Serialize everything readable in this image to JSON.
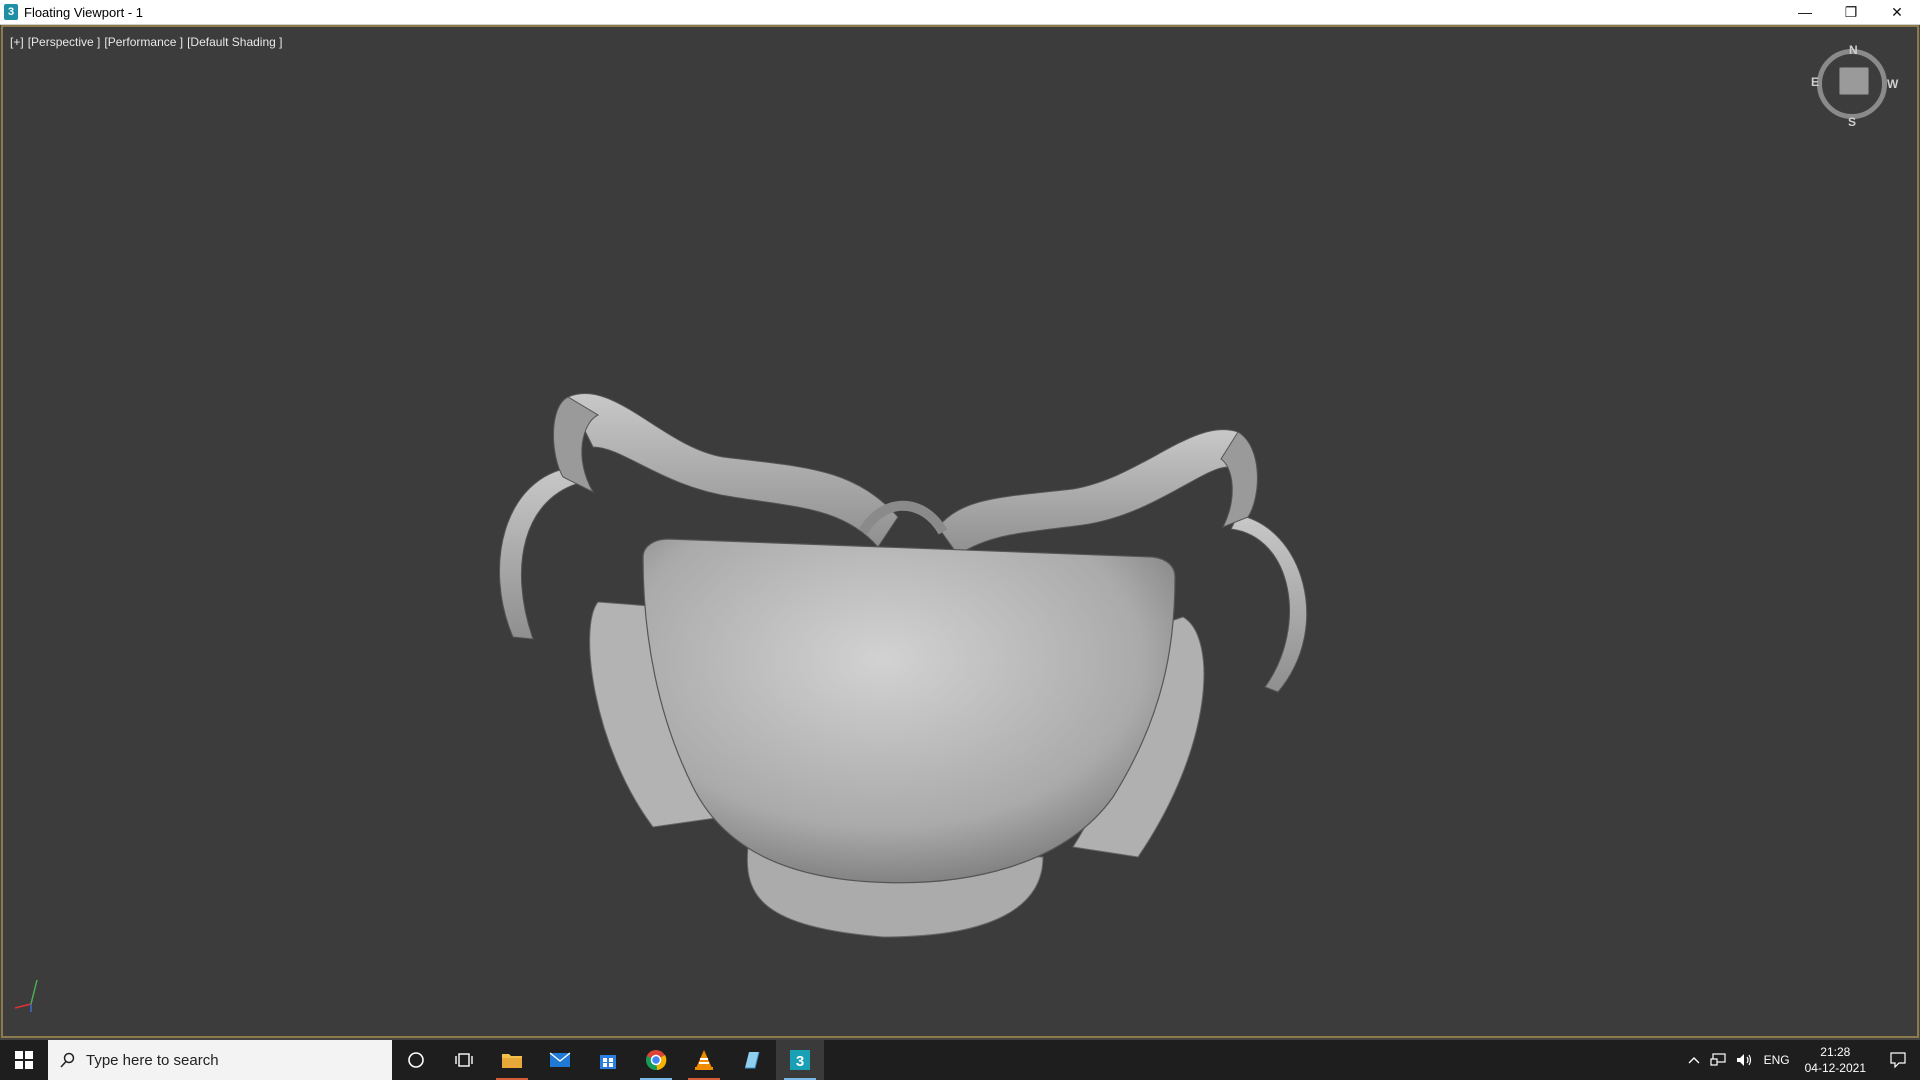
{
  "window": {
    "title": "Floating Viewport - 1",
    "app_icon": "3ds-max-icon",
    "controls": {
      "minimize": "—",
      "restore": "❐",
      "close": "✕"
    }
  },
  "viewport": {
    "labels": {
      "plus": "[+]",
      "view": "[Perspective ]",
      "mode": "[Performance ]",
      "shading": "[Default Shading ]"
    },
    "viewcube": {
      "north": "N",
      "south": "S",
      "east": "E",
      "west": "W"
    },
    "model": "backpack-mesh",
    "colors": {
      "background": "#3c3c3c",
      "border": "#8c7a4a",
      "mesh": "#b8b8b8"
    }
  },
  "taskbar": {
    "search_placeholder": "Type here to search",
    "apps": [
      "start-icon",
      "cortana-icon",
      "task-view-icon",
      "file-explorer-icon",
      "mail-icon",
      "store-icon",
      "chrome-icon",
      "vlc-icon",
      "notepad-icon",
      "3ds-max-icon"
    ],
    "tray": {
      "language": "ENG",
      "time": "21:28",
      "date": "04-12-2021"
    }
  }
}
